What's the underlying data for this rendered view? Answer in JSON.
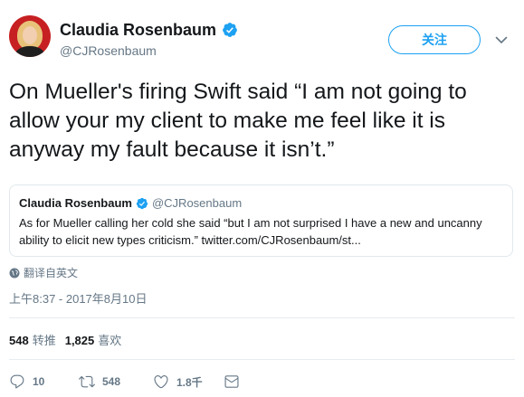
{
  "header": {
    "display_name": "Claudia Rosenbaum",
    "handle": "@CJRosenbaum",
    "follow_label": "关注"
  },
  "tweet": {
    "text": "On Mueller's firing Swift said “I am not going to allow your my client to make me feel like it is anyway my fault because it isn’t.”"
  },
  "quote": {
    "display_name": "Claudia Rosenbaum",
    "handle": "@CJRosenbaum",
    "text": "As for Mueller calling her cold she said “but I am not surprised I have a new and uncanny ability to elicit new types criticism.” twitter.com/CJRosenbaum/st..."
  },
  "translate_label": "翻译自英文",
  "timestamp": "上午8:37 - 2017年8月10日",
  "stats": {
    "retweets_count": "548",
    "retweets_label": "转推",
    "likes_count": "1,825",
    "likes_label": "喜欢"
  },
  "actions": {
    "reply_count": "10",
    "retweet_count": "548",
    "like_count": "1.8千"
  },
  "colors": {
    "accent": "#1da1f2",
    "secondary_text": "#657786",
    "primary_text": "#14171a",
    "border": "#e1e8ed"
  },
  "icons": {
    "verified": "verified-badge-icon",
    "caret": "chevron-down-icon",
    "globe": "globe-icon",
    "reply": "reply-icon",
    "retweet": "retweet-icon",
    "like": "heart-icon",
    "dm": "envelope-icon"
  }
}
